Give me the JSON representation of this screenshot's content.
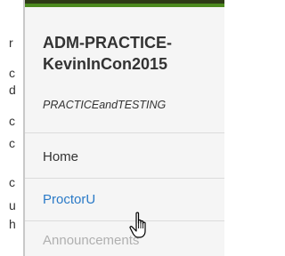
{
  "left_edge_chars": [
    "r",
    "c",
    "d",
    "c",
    "c",
    "c",
    "u",
    "h"
  ],
  "course": {
    "title": "ADM-PRACTICE-KevinInCon2015",
    "subtitle": "PRACTICEandTESTING"
  },
  "nav": {
    "items": [
      {
        "label": "Home",
        "state": "normal"
      },
      {
        "label": "ProctorU",
        "state": "link"
      },
      {
        "label": "Announcements",
        "state": "disabled"
      }
    ]
  },
  "colors": {
    "top_bar_dark": "#2e3b16",
    "top_bar_green": "#4c8a1e",
    "link": "#2a7ac7",
    "disabled": "#b0b0b0"
  },
  "cursor": {
    "type": "hand-pointer"
  }
}
